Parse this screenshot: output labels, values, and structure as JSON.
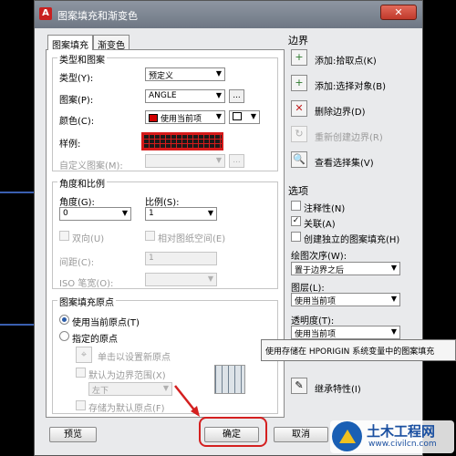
{
  "window": {
    "title": "图案填充和渐变色",
    "close_glyph": "✕"
  },
  "tabs": [
    {
      "label": "图案填充"
    },
    {
      "label": "渐变色"
    }
  ],
  "type_pattern": {
    "group_title": "类型和图案",
    "type_label": "类型(Y):",
    "type_value": "预定义",
    "pattern_label": "图案(P):",
    "pattern_value": "ANGLE",
    "color_label": "颜色(C):",
    "color_value": "使用当前项",
    "bgcolor_value": "",
    "sample_label": "样例:",
    "custom_label": "自定义图案(M):",
    "custom_value": ""
  },
  "angle_scale": {
    "group_title": "角度和比例",
    "angle_label": "角度(G):",
    "angle_value": "0",
    "scale_label": "比例(S):",
    "scale_value": "1",
    "double_label": "双向(U)",
    "relative_label": "相对图纸空间(E)",
    "spacing_label": "间距(C):",
    "spacing_value": "1",
    "iso_label": "ISO 笔宽(O):",
    "iso_value": ""
  },
  "origin": {
    "group_title": "图案填充原点",
    "current_label": "使用当前原点(T)",
    "specified_label": "指定的原点",
    "click_label": "单击以设置新原点",
    "default_extents_label": "默认为边界范围(X)",
    "corner_value": "左下",
    "store_label": "存储为默认原点(F)"
  },
  "boundaries": {
    "title": "边界",
    "items": [
      {
        "label": "添加:拾取点(K)",
        "icon": "+",
        "disabled": false
      },
      {
        "label": "添加:选择对象(B)",
        "icon": "+",
        "disabled": false
      },
      {
        "label": "删除边界(D)",
        "icon": "✕",
        "disabled": false
      },
      {
        "label": "重新创建边界(R)",
        "icon": "↻",
        "disabled": true
      },
      {
        "label": "查看选择集(V)",
        "icon": "🔍",
        "disabled": false
      }
    ]
  },
  "options": {
    "title": "选项",
    "annotative_label": "注释性(N)",
    "annotative_checked": false,
    "associative_label": "关联(A)",
    "associative_checked": true,
    "separate_label": "创建独立的图案填充(H)",
    "separate_checked": false,
    "draw_order_label": "绘图次序(W):",
    "draw_order_value": "置于边界之后",
    "layer_label": "图层(L):",
    "layer_value": "使用当前项",
    "transparency_label": "透明度(T):",
    "transparency_value": "使用当前项"
  },
  "inherit": {
    "label": "继承特性(I)"
  },
  "tooltip": {
    "text": "使用存储在 HPORIGIN 系统变量中的图案填充"
  },
  "footer": {
    "preview_label": "预览",
    "ok_label": "确定",
    "cancel_label": "取消"
  },
  "logo": {
    "name": "土木工程网",
    "url": "www.civilcn.com"
  }
}
